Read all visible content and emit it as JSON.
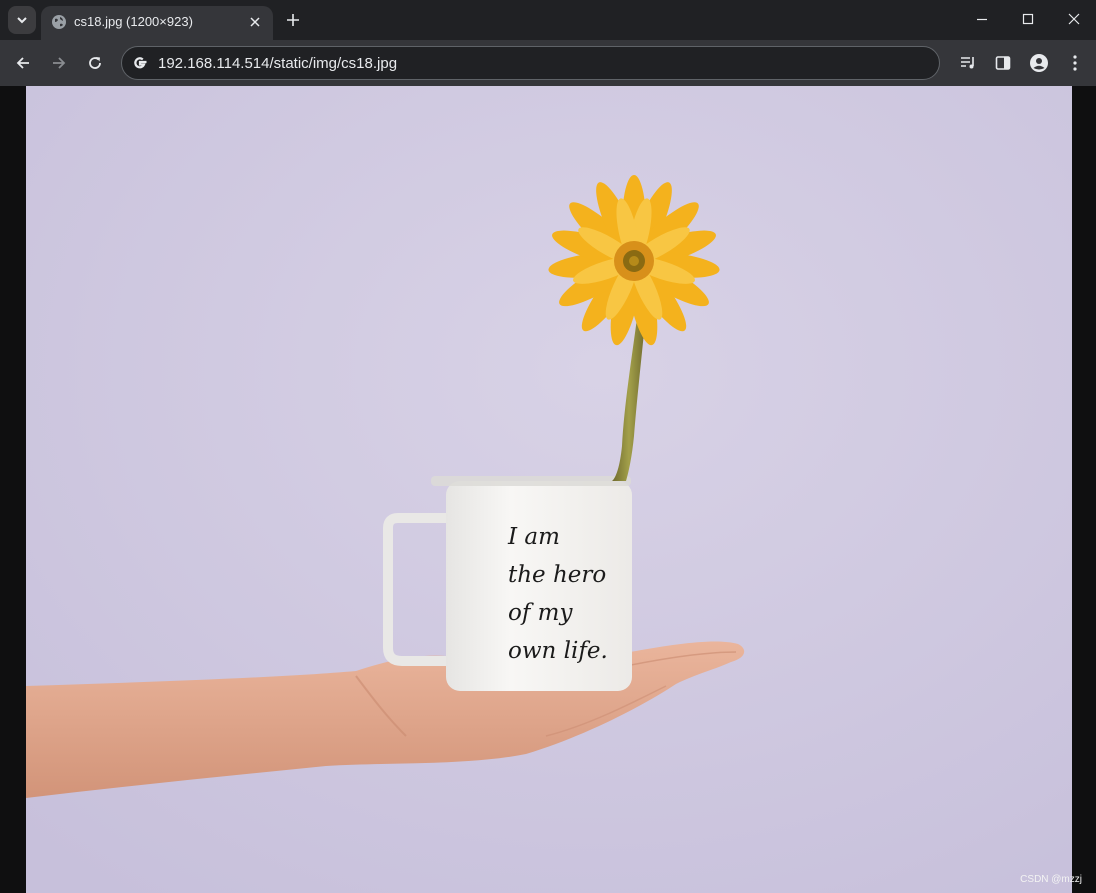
{
  "browser": {
    "tab": {
      "title": "cs18.jpg (1200×923)"
    },
    "address_bar": {
      "url": "192.168.114.514/static/img/cs18.jpg"
    }
  },
  "image": {
    "mug_text_lines": [
      "I am",
      "the hero",
      "of my",
      "own life."
    ],
    "watermark": "CSDN @mzzj",
    "colors": {
      "background": "#cec8de",
      "petals": "#f4b21d",
      "flower_center": "#d8901a",
      "stem": "#8a8a3a",
      "mug": "#f3f2f0",
      "skin": "#e2a98f"
    }
  },
  "colors": {
    "tabstrip": "#202124",
    "toolbar": "#35363a",
    "text": "#e8eaed"
  }
}
